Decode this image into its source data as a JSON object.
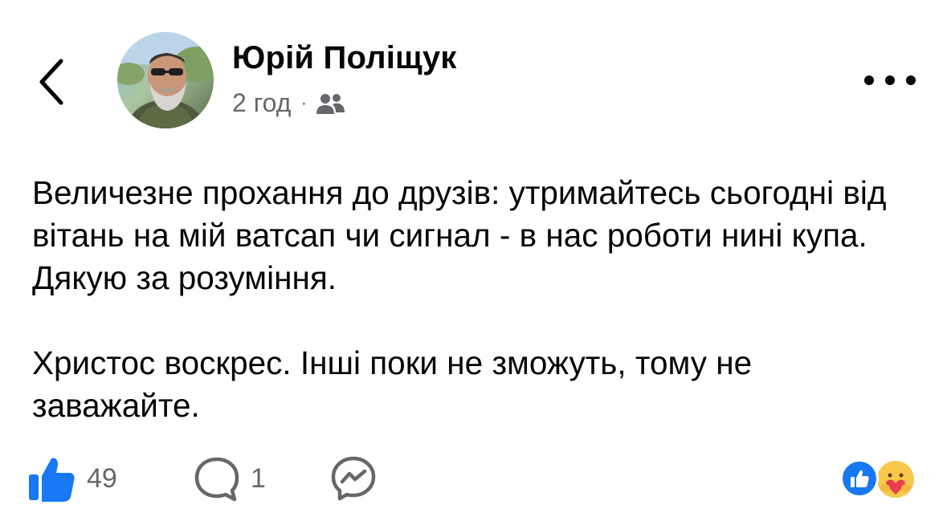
{
  "header": {
    "author_name": "Юрій Поліщук",
    "timestamp": "2 год",
    "separator": "·",
    "audience_icon": "friends-icon",
    "back_icon": "chevron-left-icon",
    "more_icon": "more-horizontal-icon"
  },
  "post": {
    "paragraphs": [
      "Величезне прохання до друзів: утримайтесь сьогодні від вітань на мій ватсап чи сигнал - в нас роботи нині купа. Дякую за розуміння.",
      "Христос воскрес. Інші поки не зможуть, тому не заважайте."
    ]
  },
  "actions": {
    "like_count": "49",
    "comment_count": "1",
    "like_icon": "thumbs-up-icon",
    "comment_icon": "comment-bubble-icon",
    "share_icon": "messenger-icon"
  },
  "reactions": {
    "items": [
      "like-reaction-icon",
      "care-reaction-icon"
    ]
  },
  "colors": {
    "accent": "#1877f2",
    "secondary_text": "#65676b",
    "primary_text": "#050505"
  }
}
